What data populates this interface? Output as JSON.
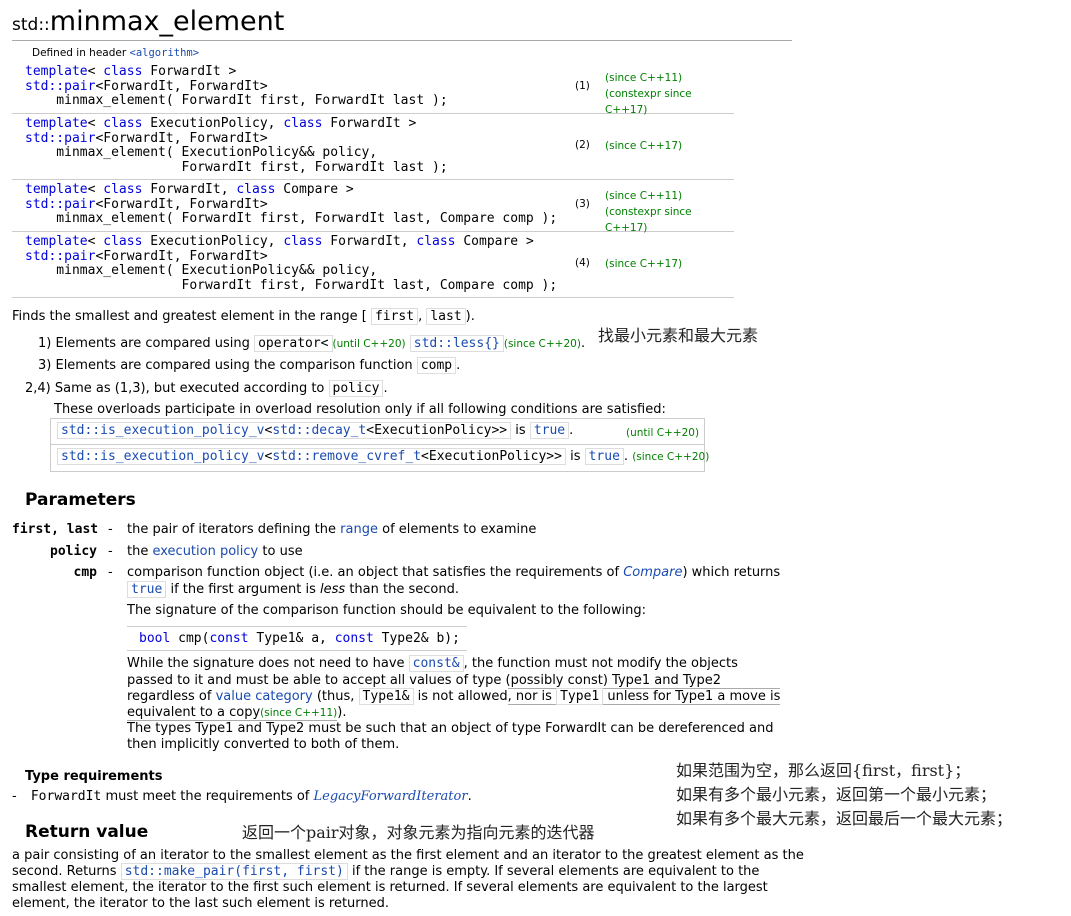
{
  "title": {
    "prefix": "std::",
    "name": "minmax_element"
  },
  "header_line": {
    "defined_in": "Defined in header ",
    "header": "<algorithm>"
  },
  "declarations": [
    {
      "num": "(1)",
      "lines": [
        "template< class ForwardIt >",
        "std::pair<ForwardIt, ForwardIt>",
        "    minmax_element( ForwardIt first, ForwardIt last );"
      ],
      "versions": [
        "(since C++11)",
        "(constexpr since C++17)"
      ]
    },
    {
      "num": "(2)",
      "lines": [
        "template< class ExecutionPolicy, class ForwardIt >",
        "std::pair<ForwardIt, ForwardIt>",
        "    minmax_element( ExecutionPolicy&& policy,",
        "                    ForwardIt first, ForwardIt last );"
      ],
      "versions": [
        "(since C++17)"
      ]
    },
    {
      "num": "(3)",
      "lines": [
        "template< class ForwardIt, class Compare >",
        "std::pair<ForwardIt, ForwardIt>",
        "    minmax_element( ForwardIt first, ForwardIt last, Compare comp );"
      ],
      "versions": [
        "(since C++11)",
        "(constexpr since C++17)"
      ]
    },
    {
      "num": "(4)",
      "lines": [
        "template< class ExecutionPolicy, class ForwardIt, class Compare >",
        "std::pair<ForwardIt, ForwardIt>",
        "    minmax_element( ExecutionPolicy&& policy,",
        "                    ForwardIt first, ForwardIt last, Compare comp );"
      ],
      "versions": [
        "(since C++17)"
      ]
    }
  ],
  "intro": {
    "text": "Finds the smallest and greatest element in the range [",
    "first": "first",
    "comma": ",",
    "last": "last",
    "close": ")."
  },
  "items": {
    "i1_label": "1)",
    "i1_text": "Elements are compared using",
    "i1_op": "operator<",
    "i1_until": "(until C++20)",
    "i1_less": "std::less{}",
    "i1_since": "(since C++20)",
    "i1_end": ".",
    "i3_label": "3)",
    "i3_text": "Elements are compared using the comparison function",
    "i3_code": "comp",
    "i3_end": ".",
    "i24_label": "2,4)",
    "i24_text": "Same as (1,3), but executed according to",
    "i24_code": "policy",
    "i24_end": ".",
    "overload_note": "These overloads participate in overload resolution only if all following conditions are satisfied:"
  },
  "conditions": [
    {
      "a": "std::is_execution_policy_v",
      "b": "<",
      "c": "std::decay_t",
      "d": "<ExecutionPolicy>>",
      "is": "is",
      "val": "true",
      "end": ".",
      "ver": "(until C++20)"
    },
    {
      "a": "std::is_execution_policy_v",
      "b": "<",
      "c": "std::remove_cvref_t",
      "d": "<ExecutionPolicy>>",
      "is": "is",
      "val": "true",
      "end": ".",
      "ver": "(since C++20)"
    }
  ],
  "annotations": {
    "find": "找最小元素和最大元素",
    "ret": "返回一个pair对象，对象元素为指向元素的迭代器",
    "rules": [
      "如果范围为空，那么返回{first，first}；",
      "如果有多个最小元素，返回第一个最小元素；",
      "如果有多个最大元素，返回最后一个最大元素；"
    ]
  },
  "parameters": {
    "heading": "Parameters",
    "dash": "-",
    "p1_name": "first, last",
    "p1_a": "the pair of iterators defining the",
    "p1_link": "range",
    "p1_b": "of elements to examine",
    "p2_name": "policy",
    "p2_a": "the",
    "p2_link": "execution policy",
    "p2_b": "to use",
    "p3_name": "cmp",
    "p3_a": "comparison function object (i.e. an object that satisfies the requirements of",
    "p3_link": "Compare",
    "p3_b": ") which returns",
    "p3_true": "true",
    "p3_c": "if the first argument is",
    "p3_less": "less",
    "p3_d": "than the second.",
    "sig_intro": "The signature of the comparison function should be equivalent to the following:",
    "sig": [
      "bool",
      " cmp(",
      "const",
      " Type1& a, ",
      "const",
      " Type2& b);"
    ],
    "w1a": "While the signature does not need to have",
    "w1code": "const&",
    "w1b": ", the function must not modify the objects",
    "w2": "passed to it and must be able to accept all values of type (possibly const) Type1 and Type2",
    "w3a": "regardless of",
    "w3link": "value category",
    "w3b": "(thus,",
    "w3code": "Type1&",
    "w3c": "is not allowed",
    "w3d": ", nor is",
    "w3code2": "Type1",
    "w3e": "unless for Type1 a move is",
    "w4a": "equivalent to a copy",
    "w4since": "(since C++11)",
    "w4b": ").",
    "t1": "The types Type1 and Type2 must be such that an object of type ForwardIt can be dereferenced and",
    "t2": "then implicitly converted to both of them."
  },
  "type_req": {
    "heading": "Type requirements",
    "dash": "-",
    "name": "ForwardIt",
    "text": "must meet the requirements of",
    "link": "LegacyForwardIterator",
    "end": "."
  },
  "return": {
    "heading": "Return value",
    "l1": "a pair consisting of an iterator to the smallest element as the first element and an iterator to the greatest element as the",
    "l2a": "second. Returns",
    "l2code": "std::make_pair(first, first)",
    "l2b": "if the range is empty. If several elements are equivalent to the",
    "l3": "smallest element, the iterator to the first such element is returned. If several elements are equivalent to the largest",
    "l4": "element, the iterator to the last such element is returned."
  }
}
